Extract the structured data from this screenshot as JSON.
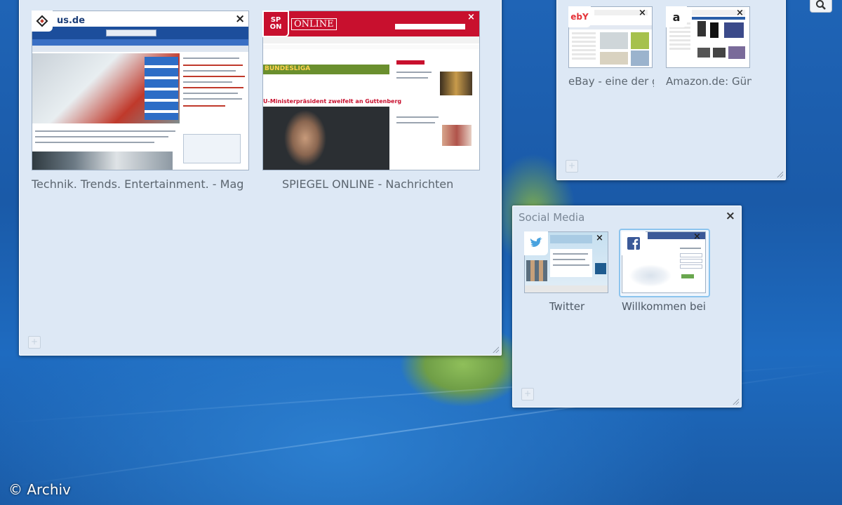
{
  "groups": {
    "main": {
      "tabs": [
        {
          "title": "Technik. Trends. Entertainment. - Mag",
          "favicon_text": "us.de"
        },
        {
          "title": "SPIEGEL ONLINE - Nachrichten",
          "favicon_text": "SP ON",
          "logo_text": "ONLINE",
          "banner_text": "BUNDESLIGA",
          "headline": "U-Ministerpräsident zweifelt an Guttenberg"
        }
      ]
    },
    "shopping": {
      "tabs": [
        {
          "title": "eBay - eine der g",
          "favicon_text": "ebY"
        },
        {
          "title": "Amazon.de: Güns",
          "favicon_text": "a"
        }
      ]
    },
    "social": {
      "title": "Social Media",
      "tabs": [
        {
          "title": "Twitter"
        },
        {
          "title": "Willkommen bei F"
        }
      ]
    }
  },
  "close_glyph": "×",
  "add_glyph": "+",
  "watermark": "© Archiv",
  "colors": {
    "group_bg": "#dde8f5",
    "spiegel_red": "#c8102e",
    "twitter_blue": "#4aa3df",
    "facebook_blue": "#3b5998",
    "desktop_blue": "#1f64b6"
  }
}
